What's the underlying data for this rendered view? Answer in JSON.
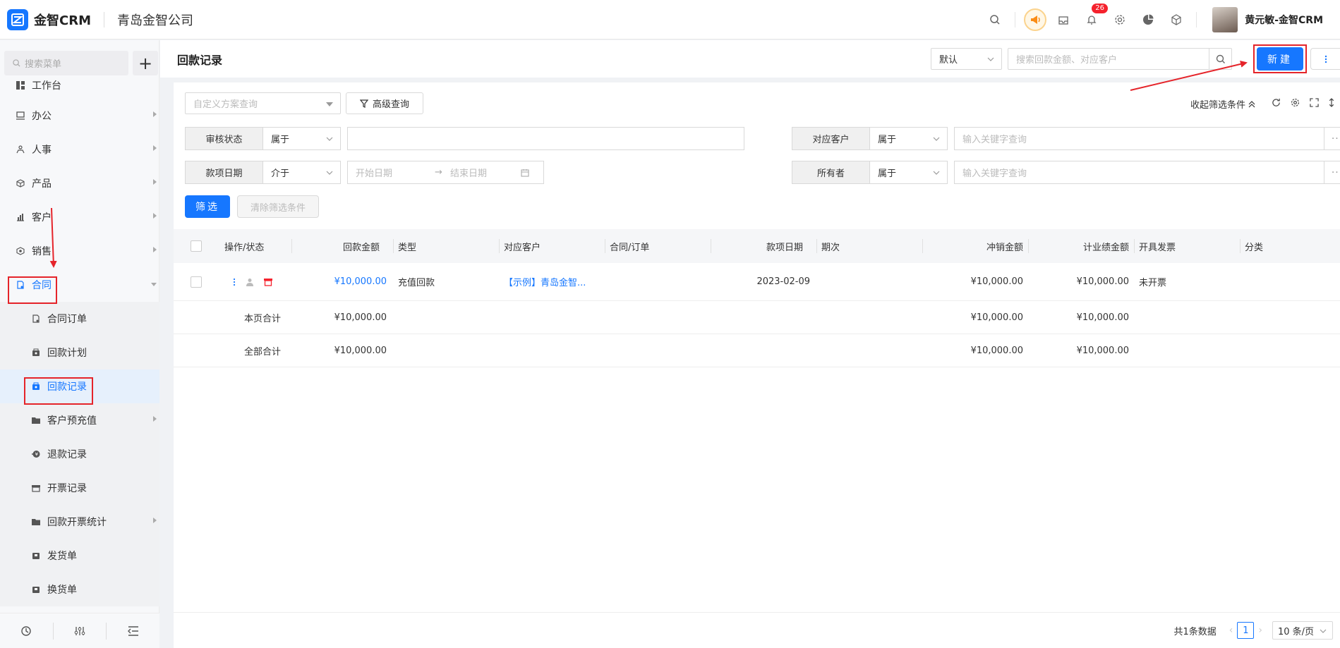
{
  "header": {
    "brand": "金智CRM",
    "company": "青岛金智公司",
    "notification_count": "26",
    "username": "黄元敏-金智CRM"
  },
  "sidebar": {
    "search_placeholder": "搜索菜单",
    "add_label": "+",
    "items": [
      {
        "label": "工作台",
        "icon": "dashboard-icon"
      },
      {
        "label": "办公",
        "icon": "monitor-icon"
      },
      {
        "label": "人事",
        "icon": "org-icon"
      },
      {
        "label": "产品",
        "icon": "cube-icon"
      },
      {
        "label": "客户",
        "icon": "chart-icon"
      },
      {
        "label": "销售",
        "icon": "target-icon"
      },
      {
        "label": "合同",
        "icon": "contract-icon"
      },
      {
        "label": "合同订单",
        "icon": "doc-icon"
      },
      {
        "label": "回款计划",
        "icon": "wallet-icon"
      },
      {
        "label": "回款记录",
        "icon": "wallet-icon"
      },
      {
        "label": "客户预充值",
        "icon": "folder-icon"
      },
      {
        "label": "退款记录",
        "icon": "refund-icon"
      },
      {
        "label": "开票记录",
        "icon": "invoice-icon"
      },
      {
        "label": "回款开票统计",
        "icon": "folder-icon"
      },
      {
        "label": "发货单",
        "icon": "box-icon"
      },
      {
        "label": "换货单",
        "icon": "box-icon"
      }
    ]
  },
  "main": {
    "title": "回款记录",
    "view_select": "默认",
    "search_placeholder": "搜索回款金额、对应客户",
    "new_button": "新建",
    "plan_placeholder": "自定义方案查询",
    "advanced_query": "高级查询",
    "collapse_filters": "收起筛选条件",
    "filters": {
      "audit_status": {
        "label": "审核状态",
        "op": "属于"
      },
      "customer": {
        "label": "对应客户",
        "op": "属于",
        "placeholder": "输入关键字查询"
      },
      "date": {
        "label": "款项日期",
        "op": "介于",
        "start": "开始日期",
        "end": "结束日期"
      },
      "owner": {
        "label": "所有者",
        "op": "属于",
        "placeholder": "输入关键字查询"
      }
    },
    "filter_button": "筛选",
    "clear_button": "清除筛选条件"
  },
  "table": {
    "columns": [
      "操作/状态",
      "回款金额",
      "类型",
      "对应客户",
      "合同/订单",
      "款项日期",
      "期次",
      "冲销金额",
      "计业绩金额",
      "开具发票",
      "分类"
    ],
    "rows": [
      {
        "amount": "¥10,000.00",
        "type": "充值回款",
        "customer": "【示例】青岛金智...",
        "contract": "",
        "date": "2023-02-09",
        "period": "",
        "offset": "¥10,000.00",
        "perf": "¥10,000.00",
        "invoice": "未开票",
        "category": ""
      }
    ],
    "page_total": {
      "label": "本页合计",
      "amount": "¥10,000.00",
      "offset": "¥10,000.00",
      "perf": "¥10,000.00"
    },
    "all_total": {
      "label": "全部合计",
      "amount": "¥10,000.00",
      "offset": "¥10,000.00",
      "perf": "¥10,000.00"
    }
  },
  "footer": {
    "total": "共1条数据",
    "page": "1",
    "page_size": "10 条/页"
  },
  "colors": {
    "primary": "#1677ff",
    "annotation": "#e5242a",
    "badge": "#f5222d"
  }
}
